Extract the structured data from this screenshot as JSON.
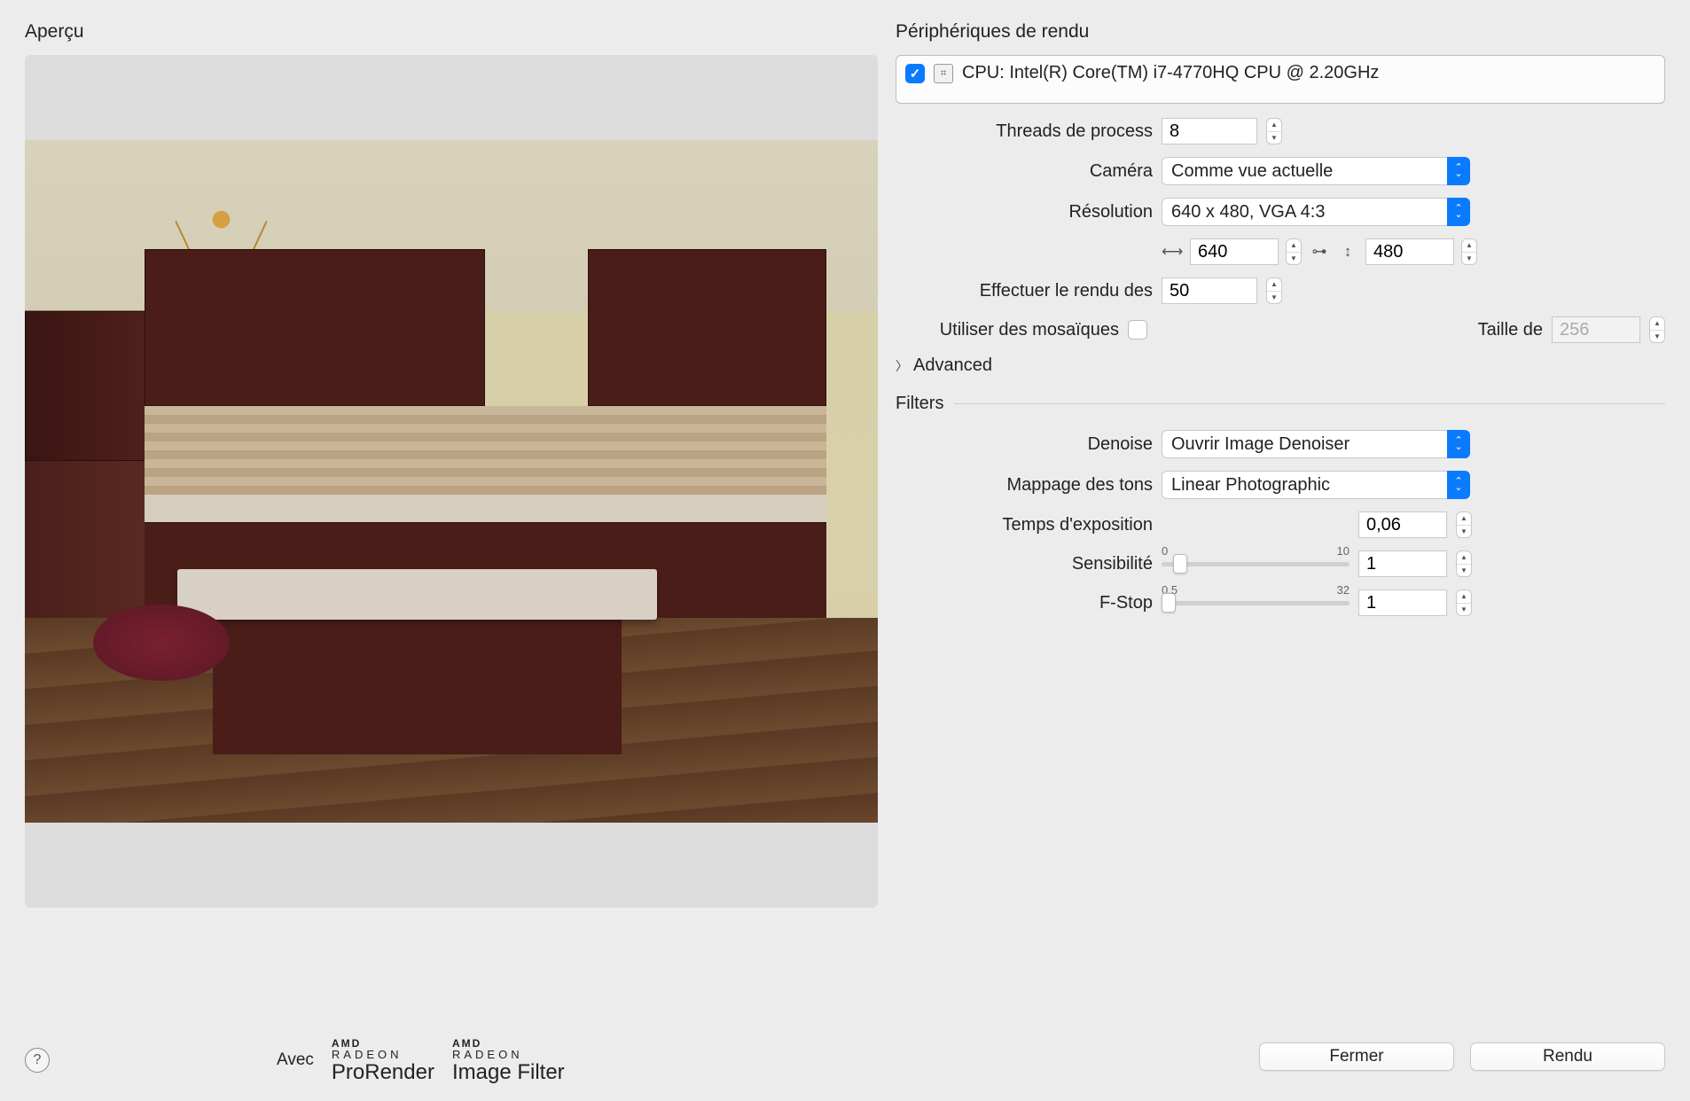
{
  "left": {
    "title": "Aperçu",
    "footer": {
      "avec": "Avec",
      "amd1_small": "AMD",
      "amd1_mid": "RADEON",
      "amd1_big": "ProRender",
      "amd2_small": "AMD",
      "amd2_mid": "RADEON",
      "amd2_big": "Image Filter",
      "help": "?"
    }
  },
  "right": {
    "title": "Périphériques de rendu",
    "device_label": "CPU: Intel(R) Core(TM) i7-4770HQ CPU @ 2.20GHz",
    "threads_label": "Threads de process",
    "threads_value": "8",
    "camera_label": "Caméra",
    "camera_value": "Comme vue actuelle",
    "resolution_label": "Résolution",
    "resolution_value": "640 x 480, VGA 4:3",
    "width_value": "640",
    "height_value": "480",
    "render_label": "Effectuer le rendu des",
    "render_value": "50",
    "tiles_label": "Utiliser des mosaïques",
    "tile_size_label": "Taille de",
    "tile_size_value": "256",
    "advanced": "Advanced",
    "filters": "Filters",
    "denoise_label": "Denoise",
    "denoise_value": "Ouvrir Image Denoiser",
    "tonemap_label": "Mappage des tons",
    "tonemap_value": "Linear Photographic",
    "exposure_label": "Temps d'exposition",
    "exposure_value": "0,06",
    "sensitivity_label": "Sensibilité",
    "sensitivity_min": "0",
    "sensitivity_max": "10",
    "sensitivity_value": "1",
    "fstop_label": "F-Stop",
    "fstop_min": "0.5",
    "fstop_max": "32",
    "fstop_value": "1",
    "close_btn": "Fermer",
    "render_btn": "Rendu"
  }
}
